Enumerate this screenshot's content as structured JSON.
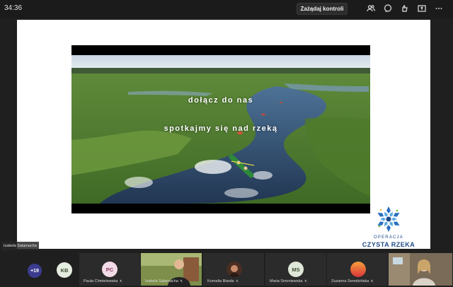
{
  "topbar": {
    "time": "34:36",
    "control_button": "Zażądaj kontroli",
    "icons": [
      "people-icon",
      "chat-icon",
      "reactions-icon",
      "share-icon",
      "more-icon"
    ]
  },
  "slide": {
    "line1": "dołącz do nas",
    "line2": "spotkajmy się nad rzeką",
    "logo_small": "OPERACJA",
    "logo_big": "CZYSTA RZEKA"
  },
  "presenter": {
    "name": "Izabela Salamacha"
  },
  "participants": {
    "overflow_count": "+19",
    "kb_initials": "KB",
    "tiles": [
      {
        "name": "Paula Chmielewska",
        "initials": "PC",
        "avatar_color": "#f3dbe7",
        "text_color": "#8a3a62",
        "type": "initials"
      },
      {
        "name": "Izabela Salamacha",
        "type": "video"
      },
      {
        "name": "Kornelia Biarda",
        "type": "photo"
      },
      {
        "name": "Maria Smoniewska",
        "initials": "MS",
        "avatar_color": "#dfe7d8",
        "text_color": "#3f4d35",
        "type": "initials"
      },
      {
        "name": "Zuzanna Seredzińska",
        "type": "photo"
      }
    ]
  },
  "colors": {
    "accent": "#1f4a86",
    "bar": "#1f1f1f",
    "overflow": "#3b3b8f"
  }
}
